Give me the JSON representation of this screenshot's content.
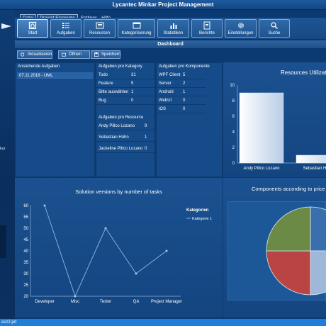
{
  "app": {
    "title": "Lycantec Minkar Project Management"
  },
  "menu": [
    "Datei",
    "Projekt Elemente",
    "Settings",
    "Hilfe"
  ],
  "toolbar": [
    {
      "label": "Start",
      "icon": "home-icon",
      "active": true
    },
    {
      "label": "Aufgaben",
      "icon": "list-icon"
    },
    {
      "label": "Resourcen",
      "icon": "resource-icon"
    },
    {
      "label": "Kategorisierung",
      "icon": "category-icon"
    },
    {
      "label": "Statistiken",
      "icon": "statistics-icon"
    },
    {
      "label": "Berichte",
      "icon": "reports-icon"
    },
    {
      "label": "Einstellungen",
      "icon": "gear-icon"
    },
    {
      "label": "Suche",
      "icon": "search-icon"
    }
  ],
  "dashboard": {
    "title": "Dashboard"
  },
  "actions": {
    "refresh": "Aktualisieren",
    "open": "Öffnen",
    "save": "Speichern"
  },
  "left": {
    "fragment": "kur"
  },
  "pending": {
    "header": "Anstehende Aufgaben",
    "items": [
      "07.11.2018 - UML"
    ]
  },
  "by_category": {
    "header": "Aufgaben pro Kategory",
    "rows": [
      [
        "Todo",
        "31"
      ],
      [
        "Feature",
        "5"
      ],
      [
        "Bitte auswählen",
        "1"
      ],
      [
        "Bug",
        "0"
      ]
    ]
  },
  "by_resource": {
    "header": "Aufgaben pro Resource",
    "rows": [
      [
        "Andy Pillco Lozano",
        "9"
      ],
      [
        "Sebastian Hühn",
        "1"
      ],
      [
        "Jackeline Pillco Lozano",
        "0"
      ]
    ]
  },
  "by_component": {
    "header": "Aufgaben pro Komponente",
    "rows": [
      [
        "WPF Client",
        "5"
      ],
      [
        "Server",
        "2"
      ],
      [
        "Android",
        "1"
      ],
      [
        "WebUI",
        "0"
      ],
      [
        "iOS",
        "0"
      ]
    ]
  },
  "resources_chart": {
    "title": "Resources Utilization",
    "ticks": [
      "10",
      "8",
      "6",
      "4",
      "2",
      "0"
    ],
    "categories": [
      "Andy Pillco Lozano",
      "Sebastian Hühn"
    ]
  },
  "versions_chart": {
    "title": "Solution versions by number of tasks",
    "legend_title": "Kategorien",
    "legend_item": "Kategorie 1",
    "yticks": [
      "60",
      "55",
      "50",
      "45",
      "40",
      "35",
      "30",
      "25",
      "20"
    ],
    "categories": [
      "Developer",
      "Misc",
      "Tester",
      "QA",
      "Project Manager"
    ]
  },
  "components_chart": {
    "title": "Components according to price"
  },
  "chart_data": [
    {
      "type": "bar",
      "title": "Resources Utilization",
      "categories": [
        "Andy Pillco Lozano",
        "Sebastian Hühn"
      ],
      "values": [
        9,
        1
      ],
      "ylim": [
        0,
        10
      ]
    },
    {
      "type": "line",
      "title": "Solution versions by number of tasks",
      "categories": [
        "Developer",
        "Misc",
        "Tester",
        "QA",
        "Project Manager"
      ],
      "series": [
        {
          "name": "Kategorie 1",
          "values": [
            60,
            20,
            50,
            30,
            40
          ]
        }
      ],
      "ylim": [
        20,
        60
      ]
    },
    {
      "type": "pie",
      "title": "Components according to price",
      "values": [
        25,
        25,
        25,
        25
      ],
      "colors": [
        "#6a8a45",
        "#b94444",
        "#3a6fae",
        "#9fb7d8"
      ]
    }
  ],
  "status": {
    "text": "ecz2.prt"
  }
}
